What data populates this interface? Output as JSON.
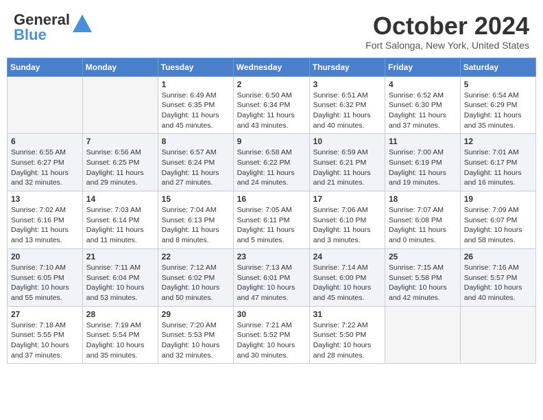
{
  "header": {
    "logo_general": "General",
    "logo_blue": "Blue",
    "month_title": "October 2024",
    "location": "Fort Salonga, New York, United States"
  },
  "days_of_week": [
    "Sunday",
    "Monday",
    "Tuesday",
    "Wednesday",
    "Thursday",
    "Friday",
    "Saturday"
  ],
  "weeks": [
    [
      {
        "day": "",
        "info": ""
      },
      {
        "day": "",
        "info": ""
      },
      {
        "day": "1",
        "info": "Sunrise: 6:49 AM\nSunset: 6:35 PM\nDaylight: 11 hours and 45 minutes."
      },
      {
        "day": "2",
        "info": "Sunrise: 6:50 AM\nSunset: 6:34 PM\nDaylight: 11 hours and 43 minutes."
      },
      {
        "day": "3",
        "info": "Sunrise: 6:51 AM\nSunset: 6:32 PM\nDaylight: 11 hours and 40 minutes."
      },
      {
        "day": "4",
        "info": "Sunrise: 6:52 AM\nSunset: 6:30 PM\nDaylight: 11 hours and 37 minutes."
      },
      {
        "day": "5",
        "info": "Sunrise: 6:54 AM\nSunset: 6:29 PM\nDaylight: 11 hours and 35 minutes."
      }
    ],
    [
      {
        "day": "6",
        "info": "Sunrise: 6:55 AM\nSunset: 6:27 PM\nDaylight: 11 hours and 32 minutes."
      },
      {
        "day": "7",
        "info": "Sunrise: 6:56 AM\nSunset: 6:25 PM\nDaylight: 11 hours and 29 minutes."
      },
      {
        "day": "8",
        "info": "Sunrise: 6:57 AM\nSunset: 6:24 PM\nDaylight: 11 hours and 27 minutes."
      },
      {
        "day": "9",
        "info": "Sunrise: 6:58 AM\nSunset: 6:22 PM\nDaylight: 11 hours and 24 minutes."
      },
      {
        "day": "10",
        "info": "Sunrise: 6:59 AM\nSunset: 6:21 PM\nDaylight: 11 hours and 21 minutes."
      },
      {
        "day": "11",
        "info": "Sunrise: 7:00 AM\nSunset: 6:19 PM\nDaylight: 11 hours and 19 minutes."
      },
      {
        "day": "12",
        "info": "Sunrise: 7:01 AM\nSunset: 6:17 PM\nDaylight: 11 hours and 16 minutes."
      }
    ],
    [
      {
        "day": "13",
        "info": "Sunrise: 7:02 AM\nSunset: 6:16 PM\nDaylight: 11 hours and 13 minutes."
      },
      {
        "day": "14",
        "info": "Sunrise: 7:03 AM\nSunset: 6:14 PM\nDaylight: 11 hours and 11 minutes."
      },
      {
        "day": "15",
        "info": "Sunrise: 7:04 AM\nSunset: 6:13 PM\nDaylight: 11 hours and 8 minutes."
      },
      {
        "day": "16",
        "info": "Sunrise: 7:05 AM\nSunset: 6:11 PM\nDaylight: 11 hours and 5 minutes."
      },
      {
        "day": "17",
        "info": "Sunrise: 7:06 AM\nSunset: 6:10 PM\nDaylight: 11 hours and 3 minutes."
      },
      {
        "day": "18",
        "info": "Sunrise: 7:07 AM\nSunset: 6:08 PM\nDaylight: 11 hours and 0 minutes."
      },
      {
        "day": "19",
        "info": "Sunrise: 7:09 AM\nSunset: 6:07 PM\nDaylight: 10 hours and 58 minutes."
      }
    ],
    [
      {
        "day": "20",
        "info": "Sunrise: 7:10 AM\nSunset: 6:05 PM\nDaylight: 10 hours and 55 minutes."
      },
      {
        "day": "21",
        "info": "Sunrise: 7:11 AM\nSunset: 6:04 PM\nDaylight: 10 hours and 53 minutes."
      },
      {
        "day": "22",
        "info": "Sunrise: 7:12 AM\nSunset: 6:02 PM\nDaylight: 10 hours and 50 minutes."
      },
      {
        "day": "23",
        "info": "Sunrise: 7:13 AM\nSunset: 6:01 PM\nDaylight: 10 hours and 47 minutes."
      },
      {
        "day": "24",
        "info": "Sunrise: 7:14 AM\nSunset: 6:00 PM\nDaylight: 10 hours and 45 minutes."
      },
      {
        "day": "25",
        "info": "Sunrise: 7:15 AM\nSunset: 5:58 PM\nDaylight: 10 hours and 42 minutes."
      },
      {
        "day": "26",
        "info": "Sunrise: 7:16 AM\nSunset: 5:57 PM\nDaylight: 10 hours and 40 minutes."
      }
    ],
    [
      {
        "day": "27",
        "info": "Sunrise: 7:18 AM\nSunset: 5:55 PM\nDaylight: 10 hours and 37 minutes."
      },
      {
        "day": "28",
        "info": "Sunrise: 7:19 AM\nSunset: 5:54 PM\nDaylight: 10 hours and 35 minutes."
      },
      {
        "day": "29",
        "info": "Sunrise: 7:20 AM\nSunset: 5:53 PM\nDaylight: 10 hours and 32 minutes."
      },
      {
        "day": "30",
        "info": "Sunrise: 7:21 AM\nSunset: 5:52 PM\nDaylight: 10 hours and 30 minutes."
      },
      {
        "day": "31",
        "info": "Sunrise: 7:22 AM\nSunset: 5:50 PM\nDaylight: 10 hours and 28 minutes."
      },
      {
        "day": "",
        "info": ""
      },
      {
        "day": "",
        "info": ""
      }
    ]
  ]
}
